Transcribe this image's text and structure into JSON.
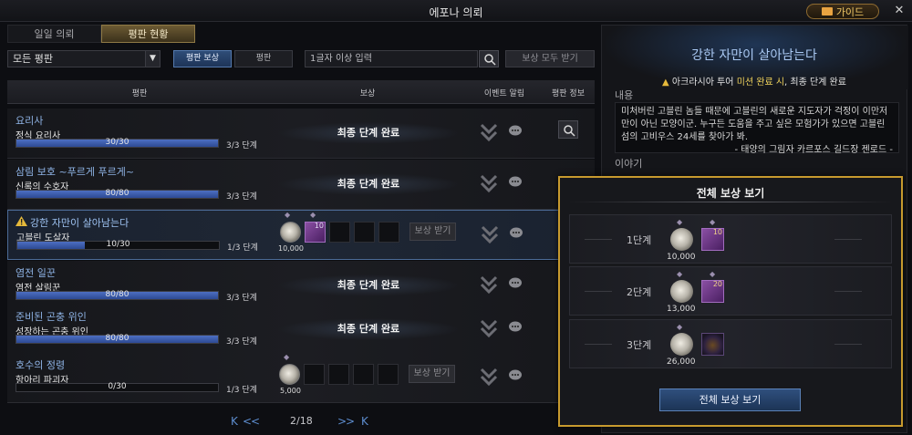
{
  "window": {
    "title": "에포나 의뢰",
    "guide_label": "가이드",
    "close": "✕"
  },
  "tabs": [
    {
      "label": "일일 의뢰"
    },
    {
      "label": "평판 현황"
    }
  ],
  "filter": {
    "dropdown_value": "모든 평판",
    "seg_reward": "평판 보상",
    "seg_rep": "평판",
    "search_placeholder": "1글자 이상 입력",
    "claim_all": "보상 모두 받기"
  },
  "headers": {
    "rep": "평판",
    "reward": "보상",
    "event": "이벤트 알림",
    "info": "평판 정보"
  },
  "rows": [
    {
      "name": "요리사",
      "sub": "정식 요리사",
      "progress": "30/30",
      "fill": 1.0,
      "stage": "3/3 단계",
      "status": "최종 단계 완료"
    },
    {
      "name": "삼림 보호 ~푸르게 푸르게~",
      "sub": "신록의 수호자",
      "progress": "80/80",
      "fill": 1.0,
      "stage": "3/3 단계",
      "status": "최종 단계 완료"
    },
    {
      "name": "강한 자만이 살아남는다",
      "sub": "고블린 도살자",
      "progress": "10/30",
      "fill": 0.333,
      "stage": "1/3 단계",
      "reward_amount": "10,000",
      "reward_card_count": "10",
      "claim": "보상 받기"
    },
    {
      "name": "염전 일꾼",
      "sub": "염전 살림꾼",
      "progress": "80/80",
      "fill": 1.0,
      "stage": "3/3 단계",
      "status": "최종 단계 완료"
    },
    {
      "name": "준비된 곤충 위인",
      "sub": "성장하는 곤충 위인",
      "progress": "80/80",
      "fill": 1.0,
      "stage": "3/3 단계",
      "status": "최종 단계 완료"
    },
    {
      "name": "호수의 정령",
      "sub": "항아리 파괴자",
      "progress": "0/30",
      "fill": 0.0,
      "stage": "1/3 단계",
      "reward_amount": "5,000",
      "claim": "보상 받기"
    }
  ],
  "pager": {
    "first": "K",
    "prev": "<<",
    "page": "2/18",
    "next": ">>",
    "last": "K"
  },
  "detail": {
    "title": "강한 자만이 살아남는다",
    "cond_pre": "아크라시아 투어 ",
    "cond_hl": "미션 완료 시",
    "cond_post": ", 최종 단계 완료",
    "content_label": "내용",
    "content_text": "미처버린 고블린 놈들 때문에 고블린의 새로운 지도자가 걱정이 이만저만이 아닌 모양이군. 누구든 도움을 주고 싶은 모험가가 있으면 고블린 섬의 고비우스 24세를 찾아가 봐.",
    "content_sig": "- 태양의 그림자 카르포스 길드장 젠로드 -",
    "story_label": "이야기"
  },
  "popup": {
    "title": "전체 보상 보기",
    "stages": [
      {
        "label": "1단계",
        "amount": "10,000",
        "count": "10"
      },
      {
        "label": "2단계",
        "amount": "13,000",
        "count": "20"
      },
      {
        "label": "3단계",
        "amount": "26,000",
        "count": ""
      }
    ],
    "button": "전체 보상 보기"
  },
  "colors": {
    "accent_blue": "#4d6fc2",
    "gold_border": "#c79a2e",
    "quest_title": "#8fb4e6"
  }
}
